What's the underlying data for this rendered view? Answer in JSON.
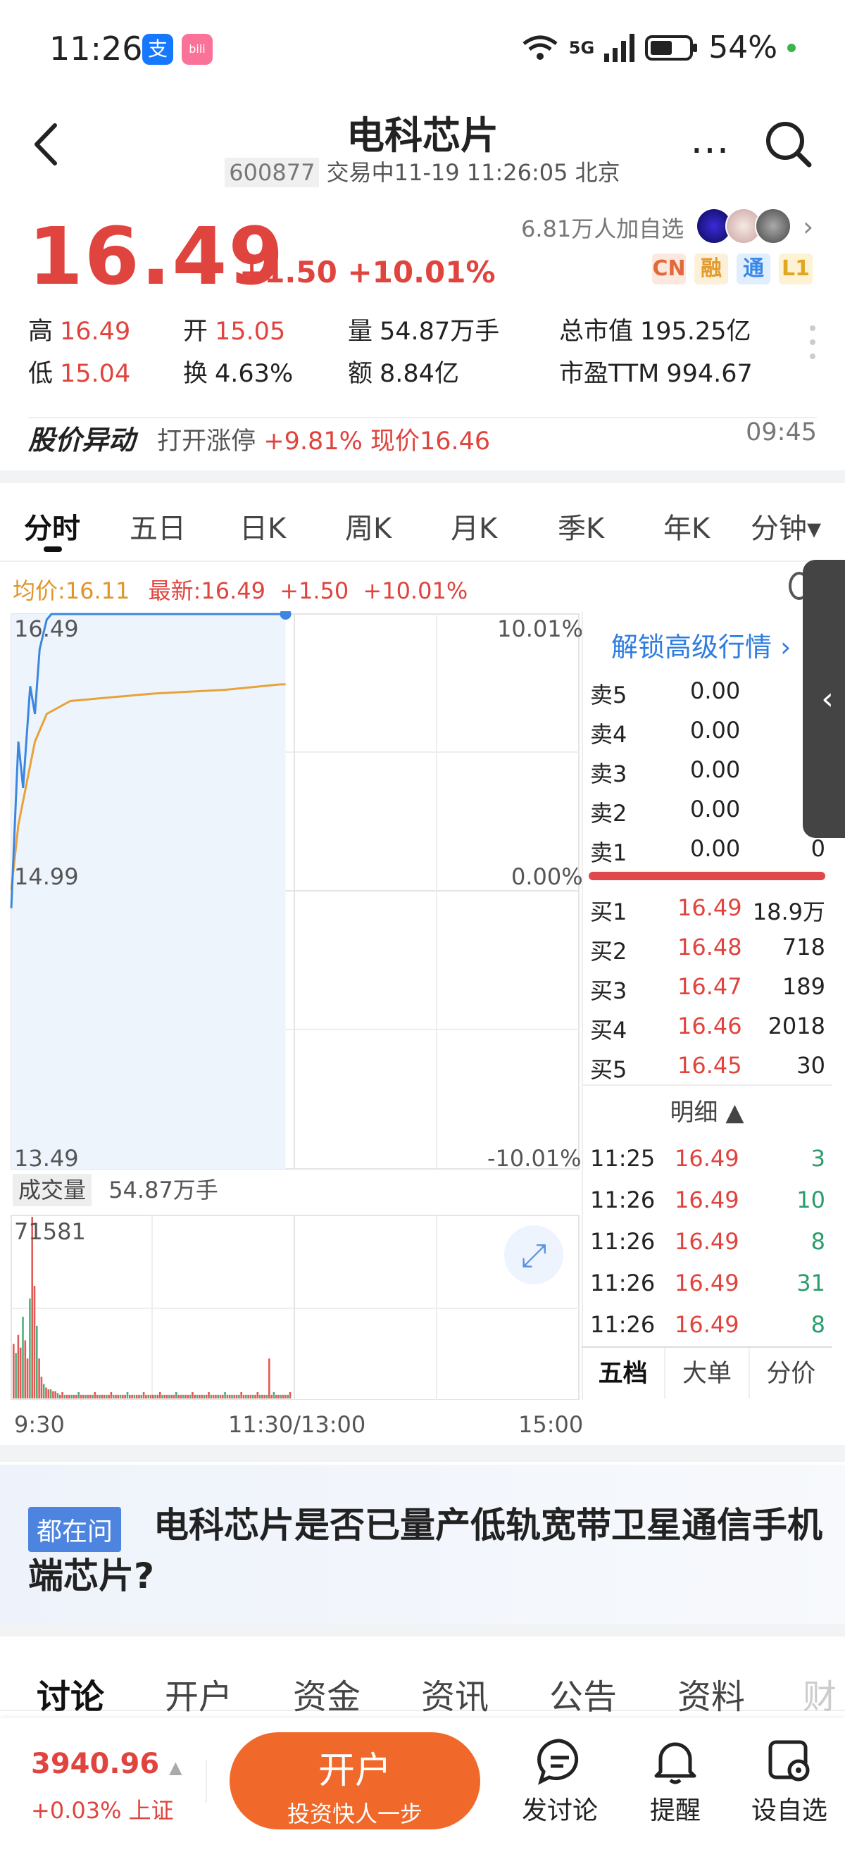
{
  "status_bar": {
    "time": "11:26",
    "network": "5G",
    "battery": "54%"
  },
  "header": {
    "title": "电科芯片",
    "code": "600877",
    "status": "交易中11-19 11:26:05 北京"
  },
  "quote": {
    "price": "16.49",
    "change": "+1.50",
    "change_pct": "+10.01%",
    "followers": "6.81万人加自选",
    "tags": [
      "CN",
      "融",
      "通",
      "L1"
    ],
    "stats": [
      {
        "label": "高",
        "value": "16.49"
      },
      {
        "label": "开",
        "value": "15.05"
      },
      {
        "label": "量",
        "value": "54.87万手"
      },
      {
        "label": "总市值",
        "value": "195.25亿"
      },
      {
        "label": "低",
        "value": "15.04"
      },
      {
        "label": "换",
        "value": "4.63%"
      },
      {
        "label": "额",
        "value": "8.84亿"
      },
      {
        "label": "市盈TTM",
        "value": "994.67"
      }
    ]
  },
  "alert": {
    "title": "股价异动",
    "text_prefix": "打开涨停",
    "text_value": "+9.81% 现价16.46",
    "time": "09:45"
  },
  "chart_tabs": [
    "分时",
    "五日",
    "日K",
    "周K",
    "月K",
    "季K",
    "年K",
    "分钟▾"
  ],
  "chart": {
    "legend_avg": "均价:16.11",
    "legend_latest": "最新:16.49",
    "legend_change": "+1.50",
    "legend_pct": "+10.01%",
    "y_labels": {
      "top": "16.49",
      "mid": "14.99",
      "bottom": "13.49"
    },
    "pct_labels": {
      "top": "10.01%",
      "mid": "0.00%",
      "bottom": "-10.01%"
    },
    "x_labels": [
      "9:30",
      "11:30/13:00",
      "15:00"
    ],
    "volume_label": "成交量",
    "volume_total": "54.87万手",
    "volume_max": "71581"
  },
  "chart_data": {
    "type": "line",
    "x_range": [
      "9:30",
      "15:00"
    ],
    "ylim": [
      13.49,
      16.49
    ],
    "series": [
      {
        "name": "最新",
        "points": [
          [
            "9:30",
            14.9
          ],
          [
            "9:33",
            15.8
          ],
          [
            "9:35",
            15.55
          ],
          [
            "9:38",
            16.1
          ],
          [
            "9:40",
            15.95
          ],
          [
            "9:42",
            16.3
          ],
          [
            "9:45",
            16.46
          ],
          [
            "9:47",
            16.49
          ],
          [
            "11:26",
            16.49
          ]
        ]
      },
      {
        "name": "均价",
        "points": [
          [
            "9:30",
            15.0
          ],
          [
            "9:33",
            15.35
          ],
          [
            "9:40",
            15.8
          ],
          [
            "9:45",
            15.95
          ],
          [
            "9:55",
            16.02
          ],
          [
            "10:30",
            16.06
          ],
          [
            "11:00",
            16.08
          ],
          [
            "11:24",
            16.11
          ],
          [
            "11:26",
            16.11
          ]
        ]
      }
    ],
    "volume": {
      "max": 71581
    }
  },
  "order_book": {
    "unlock": "解锁高级行情",
    "asks": [
      {
        "label": "卖5",
        "price": "0.00",
        "vol": ""
      },
      {
        "label": "卖4",
        "price": "0.00",
        "vol": ""
      },
      {
        "label": "卖3",
        "price": "0.00",
        "vol": ""
      },
      {
        "label": "卖2",
        "price": "0.00",
        "vol": ""
      },
      {
        "label": "卖1",
        "price": "0.00",
        "vol": "0"
      }
    ],
    "bids": [
      {
        "label": "买1",
        "price": "16.49",
        "vol": "18.9万"
      },
      {
        "label": "买2",
        "price": "16.48",
        "vol": "718"
      },
      {
        "label": "买3",
        "price": "16.47",
        "vol": "189"
      },
      {
        "label": "买4",
        "price": "16.46",
        "vol": "2018"
      },
      {
        "label": "买5",
        "price": "16.45",
        "vol": "30"
      }
    ],
    "detail_title": "明细 ▲",
    "ticks": [
      {
        "time": "11:25",
        "price": "16.49",
        "vol": "3"
      },
      {
        "time": "11:26",
        "price": "16.49",
        "vol": "10"
      },
      {
        "time": "11:26",
        "price": "16.49",
        "vol": "8"
      },
      {
        "time": "11:26",
        "price": "16.49",
        "vol": "31"
      },
      {
        "time": "11:26",
        "price": "16.49",
        "vol": "8"
      }
    ],
    "tabs": [
      "五档",
      "大单",
      "分价"
    ]
  },
  "question": {
    "badge": "都在问",
    "text": "电科芯片是否已量产低轨宽带卫星通信手机端芯片?"
  },
  "bottom_tabs": [
    "讨论",
    "开户",
    "资金",
    "资讯",
    "公告",
    "资料",
    "财"
  ],
  "bottom_bar": {
    "index_value": "3940.96",
    "index_change": "+0.03% 上证",
    "open_title": "开户",
    "open_sub": "投资快人一步",
    "discuss": "发讨论",
    "remind": "提醒",
    "watch": "设自选"
  }
}
